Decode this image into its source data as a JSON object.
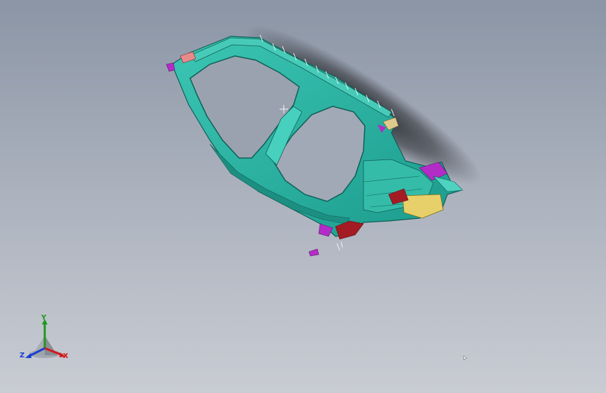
{
  "viewport": {
    "background_top": "#8b95a5",
    "background_bottom": "#c9ccd3",
    "model_color": "#2bb5a5",
    "model_dark": "#13756b",
    "accent_magenta": "#b42cc7",
    "accent_red": "#a31c24",
    "accent_yellow": "#e7d06a"
  },
  "triad": {
    "x_label": "X",
    "y_label": "Y",
    "z_label": "Z",
    "x_color": "#d01a1a",
    "y_color": "#1a9a1a",
    "z_color": "#1a3fd0"
  }
}
